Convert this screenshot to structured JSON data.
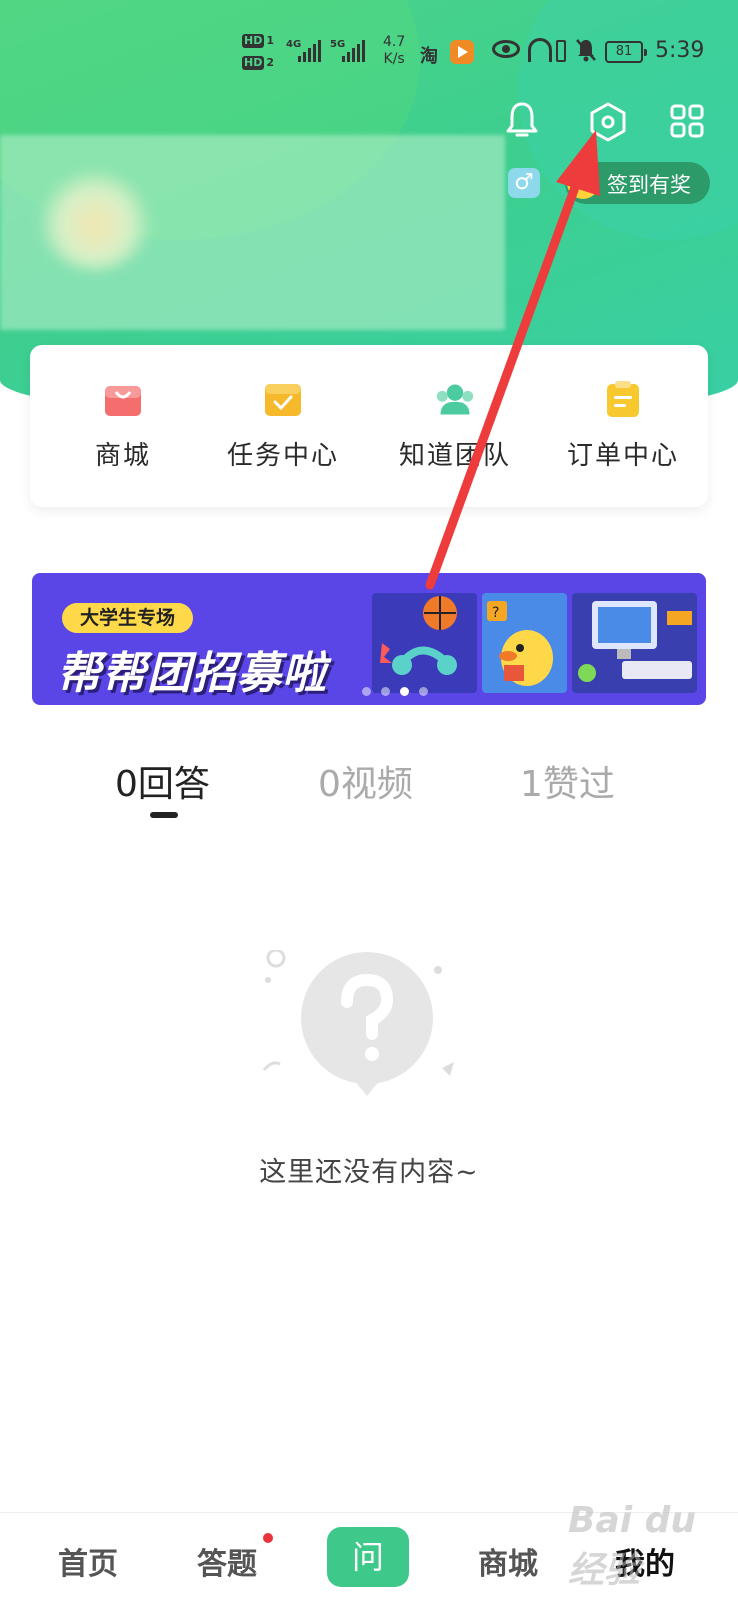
{
  "status_bar": {
    "hd1": "HD",
    "hd1_num": "1",
    "hd2": "HD",
    "hd2_num": "2",
    "sig1": "4G",
    "sig2": "5G",
    "net_speed_value": "4.7",
    "net_speed_unit": "K/s",
    "tao": "淘",
    "battery": "81",
    "time": "5:39"
  },
  "header": {
    "icons": [
      "bell-icon",
      "settings-icon",
      "grid-icon"
    ],
    "gender_symbol": "♂",
    "signin_label": "签到有奖"
  },
  "quick_menu": {
    "items": [
      {
        "label": "商城",
        "icon": "shop-bag-icon",
        "color": "#f46e6e"
      },
      {
        "label": "任务中心",
        "icon": "calendar-check-icon",
        "color": "#f6b92c"
      },
      {
        "label": "知道团队",
        "icon": "team-icon",
        "color": "#4ccba0"
      },
      {
        "label": "订单中心",
        "icon": "clipboard-icon",
        "color": "#f8c92e"
      }
    ]
  },
  "banner": {
    "tag": "大学生专场",
    "headline": "帮帮团招募啦",
    "slides": 4,
    "active_slide": 3
  },
  "tabs": [
    {
      "count": "0",
      "label": "回答",
      "active": true
    },
    {
      "count": "0",
      "label": "视频",
      "active": false
    },
    {
      "count": "1",
      "label": "赞过",
      "active": false
    }
  ],
  "empty_state": {
    "icon": "question-bubble-icon",
    "text": "这里还没有内容~"
  },
  "bottom_nav": {
    "home": "首页",
    "answer": "答题",
    "ask": "问",
    "shop": "商城",
    "mine": "我的"
  },
  "watermark": "Bai du 经验",
  "colors": {
    "brand_green": "#3ecf8e",
    "banner_purple": "#5a46e6",
    "annotation_red": "#ee3b3b"
  }
}
